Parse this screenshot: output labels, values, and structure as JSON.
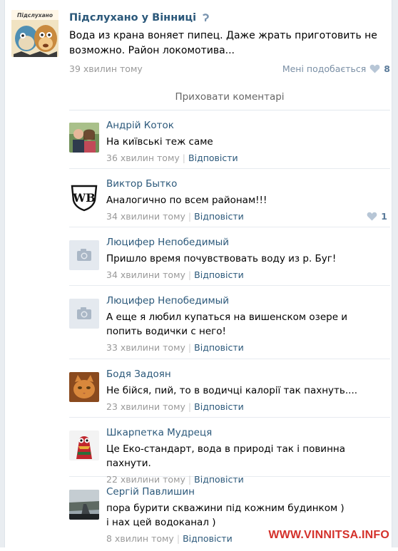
{
  "post": {
    "author": "Підслухано у Вінниці",
    "text": "Вода из крана воняет пипец. Даже жрать приготовить не возможно. Район локомотива...",
    "time": "39 хвилин тому",
    "likes_label": "Мені подобається",
    "likes_count": "8",
    "avatar_logo_text": "Підслухано"
  },
  "hide_comments": "Приховати коментарі",
  "reply_label": "Відповісти",
  "comments": [
    {
      "author": "Андрій Коток",
      "text": "На київські теж саме",
      "time": "36 хвилин тому",
      "likes": ""
    },
    {
      "author": "Виктор Бытко",
      "text": "Аналогично по всем районам!!!",
      "time": "34 хвилини тому",
      "likes": "1"
    },
    {
      "author": "Люцифер Непобедимый",
      "text": "Пришло время почувствовать воду из р. Буг!",
      "time": "34 хвилини тому",
      "likes": ""
    },
    {
      "author": "Люцифер Непобедимый",
      "text": "А еще я любил купаться на вишенском озере и попить водички с него!",
      "time": "33 хвилини тому",
      "likes": ""
    },
    {
      "author": "Бодя Задоян",
      "text": "Не бійся, пий, то в водичці калорії так пахнуть....",
      "time": "23 хвилини тому",
      "likes": ""
    },
    {
      "author": "Шкарпетка Мудреця",
      "text": "Це Еко-стандарт, вода в природі так і повинна пахнути.",
      "time": "22 хвилини тому",
      "likes": ""
    },
    {
      "author": "Сергій Павлишин",
      "text": "пора бурити скважини під кожним будинком )\nі нах цей водоканал )",
      "time": "8 хвилин тому",
      "likes": ""
    }
  ],
  "watermark": "WWW.VINNITSA.INFO",
  "colors": {
    "link": "#2b587a",
    "meta": "#999999",
    "watermark": "#d4312b"
  }
}
